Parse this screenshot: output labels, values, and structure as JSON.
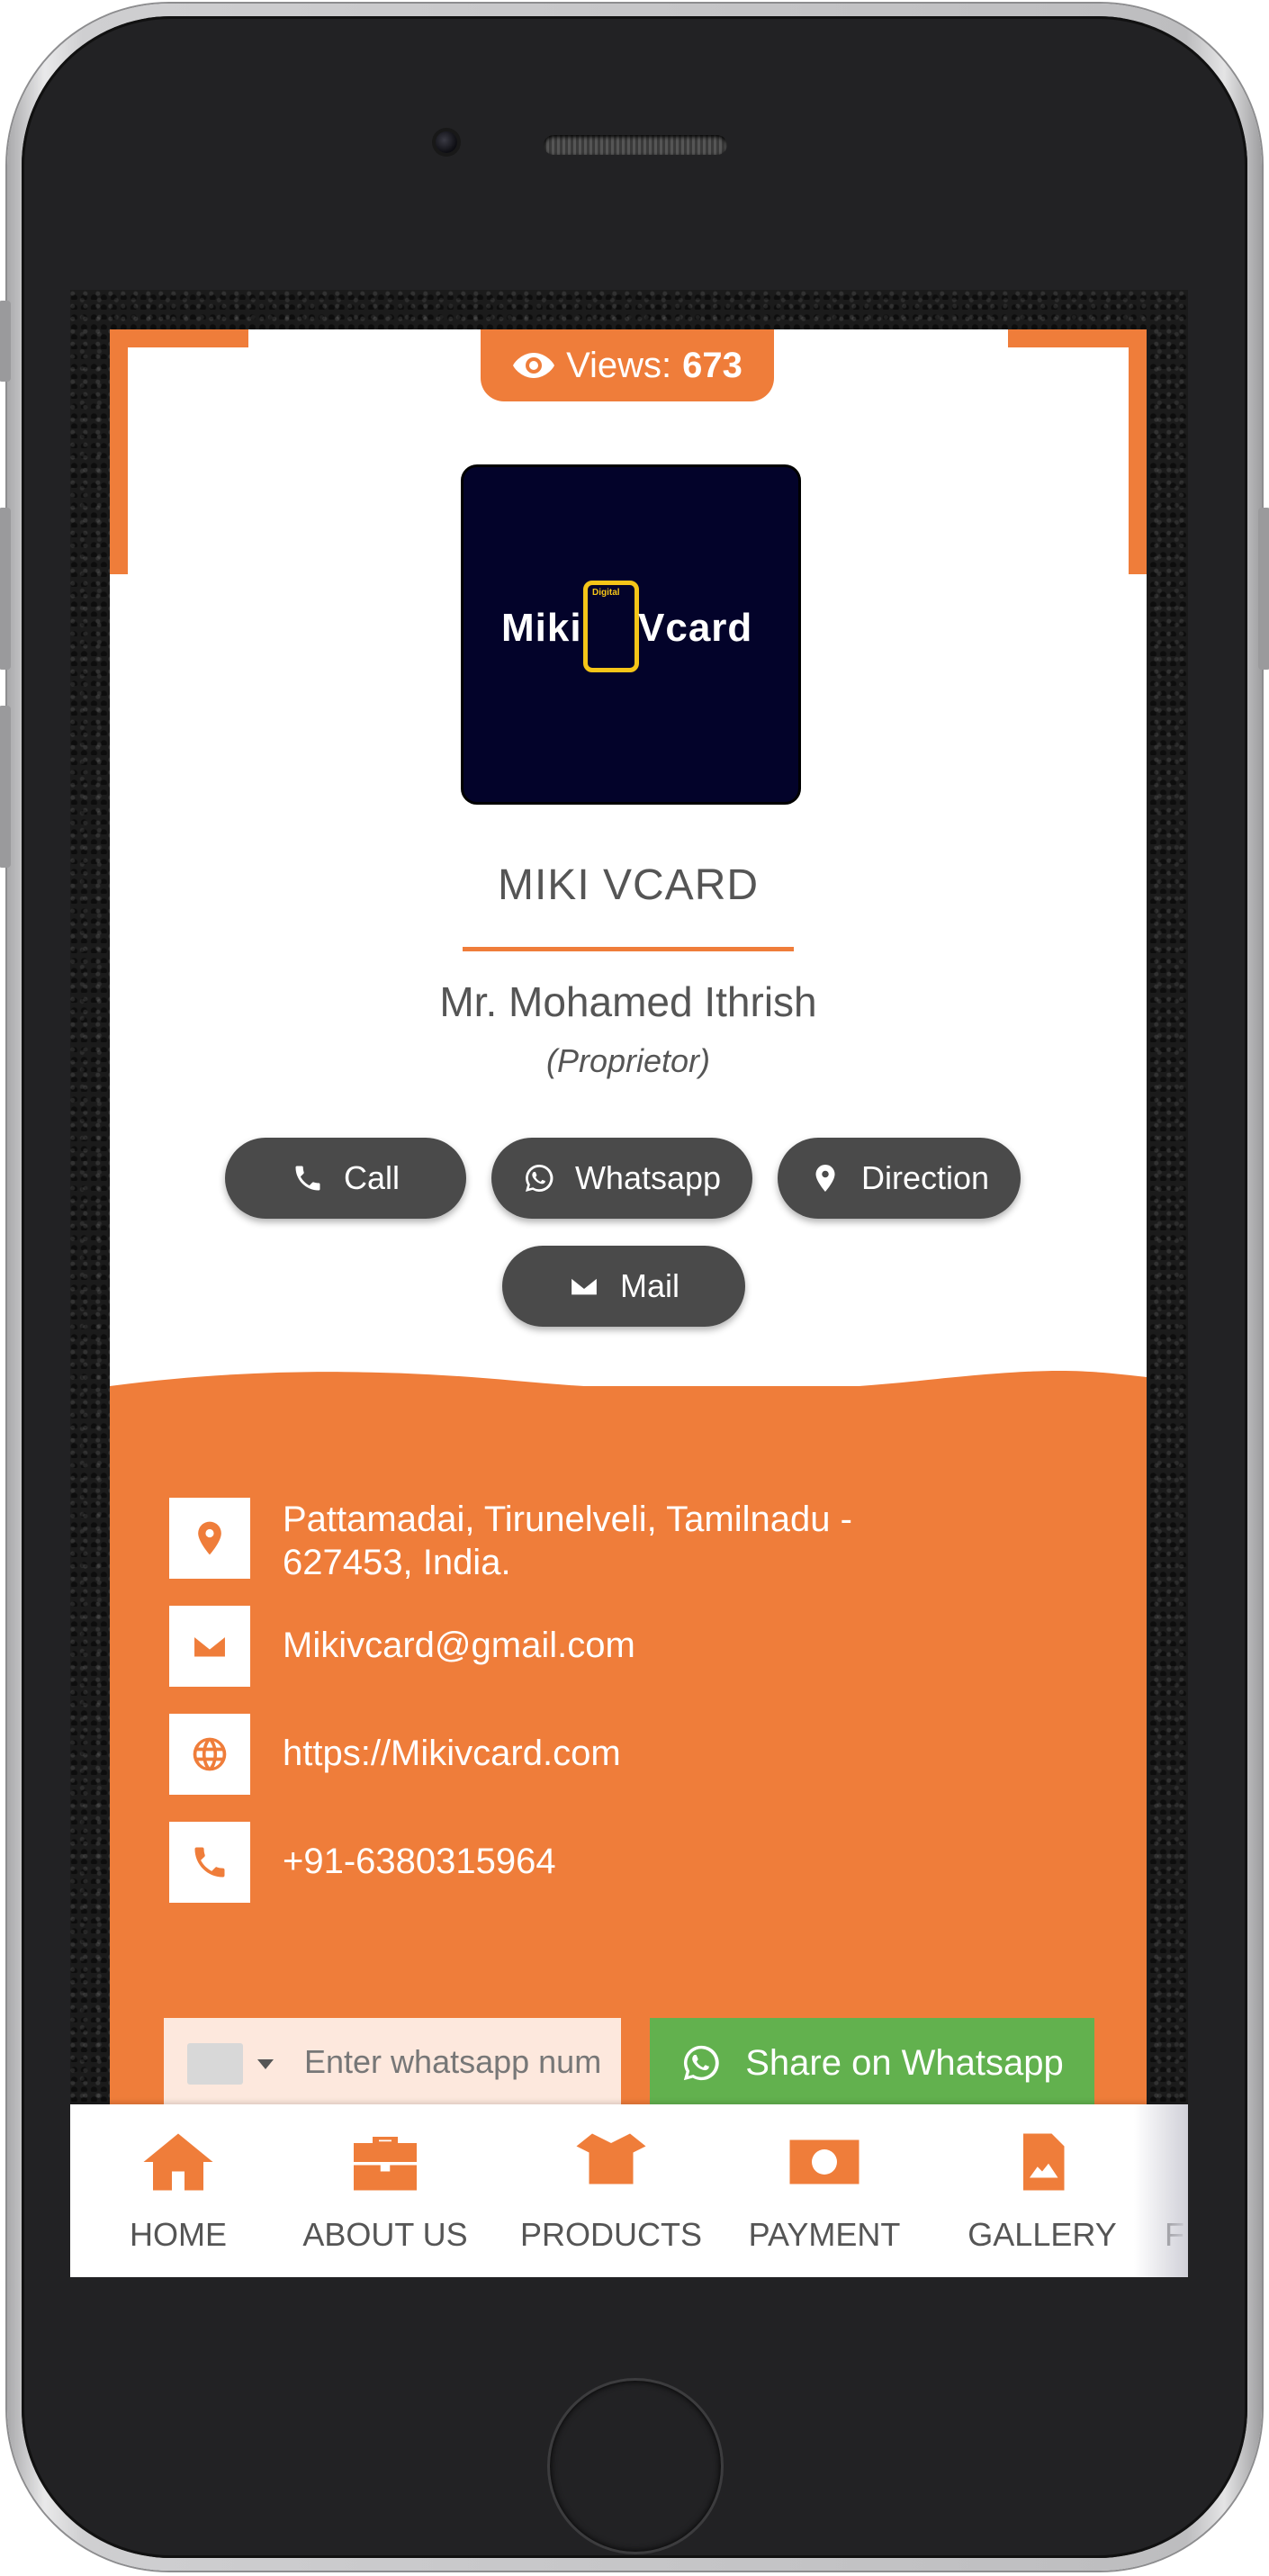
{
  "views": {
    "label": "Views:",
    "count": "673"
  },
  "logo": {
    "word1": "Miki",
    "word2": "Vcard",
    "tag": "Digital"
  },
  "profile": {
    "company": "MIKI VCARD",
    "name": "Mr. Mohamed Ithrish",
    "role": "(Proprietor)"
  },
  "actions": {
    "call": "Call",
    "whatsapp": "Whatsapp",
    "direction": "Direction",
    "mail": "Mail"
  },
  "contact": {
    "address": "Pattamadai, Tirunelveli, Tamilnadu - 627453, India.",
    "email": "Mikivcard@gmail.com",
    "website": "https://Mikivcard.com",
    "phone": "+91-6380315964"
  },
  "share": {
    "placeholder": "Enter whatsapp num",
    "button": "Share on Whatsapp"
  },
  "nav": [
    "HOME",
    "ABOUT US",
    "PRODUCTS",
    "PAYMENT",
    "GALLERY",
    "F"
  ],
  "colors": {
    "accent": "#ef7d3a",
    "dark_button": "#4a4a4a",
    "whatsapp_green": "#62b14e"
  }
}
